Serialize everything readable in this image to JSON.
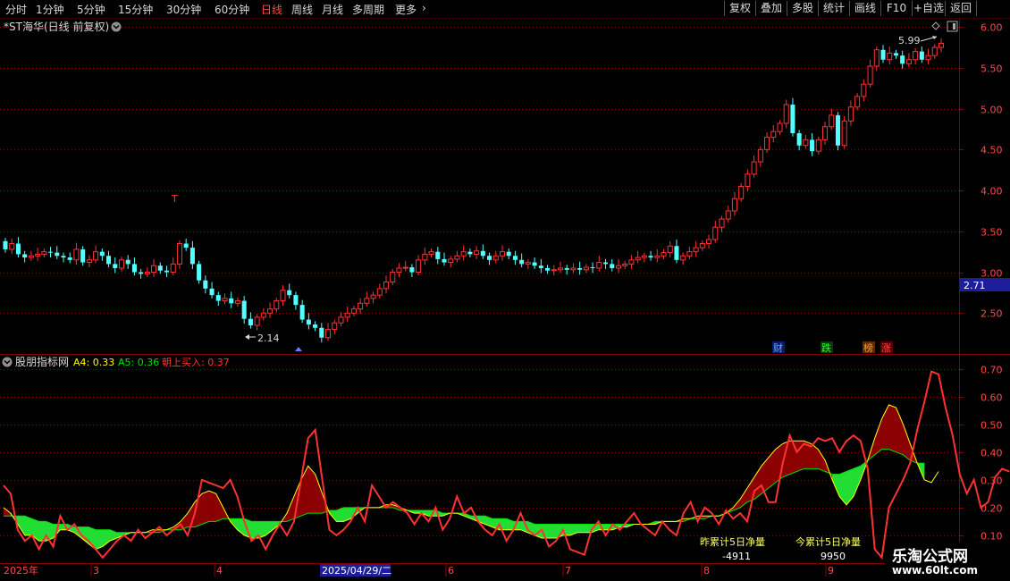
{
  "toolbar": {
    "periods": [
      "分时",
      "1分钟",
      "5分钟",
      "15分钟",
      "30分钟",
      "60分钟",
      "日线",
      "周线",
      "月线",
      "多周期",
      "更多"
    ],
    "active_period": "日线",
    "more_arrow": "›",
    "right_buttons": [
      "复权",
      "叠加",
      "多股",
      "统计",
      "画线",
      "F10",
      "+自选",
      "返回"
    ]
  },
  "main": {
    "title": "*ST海华(日线 前复权)",
    "high_marker": "5.99",
    "low_marker": "2.14",
    "current_price_tag": "2.71",
    "event_icons": [
      "财",
      "跌",
      "榜",
      "涨"
    ],
    "t_marker": "T"
  },
  "indicator": {
    "title": "股朋指标网",
    "a4_label": "A4: 0.33",
    "a5_label": "A5: 0.36",
    "buy_label": "朝上买入: 0.37",
    "prev_label": "昨累计5日净量",
    "prev_value": "-4911",
    "today_label": "今累计5日净量",
    "today_value": "9950"
  },
  "timeline": {
    "labels": [
      "2025年",
      "3",
      "4",
      "2025/04/29/二",
      "6",
      "7",
      "8",
      "9"
    ]
  },
  "watermark": {
    "line1": "乐淘公式网",
    "line2": "www.60lt.com"
  },
  "colors": {
    "up": "#ff3232",
    "down": "#54ffff",
    "grid": "#7a0000",
    "axis": "#8a0000",
    "title_text": "#d8d8d8",
    "a4": "#ffff00",
    "a5": "#00e000",
    "buy": "#ff3232",
    "green_fill": "#22dd33",
    "red_fill": "#8b0000",
    "tag_bg": "#1e1e9a"
  },
  "chart_data": [
    {
      "type": "candlestick",
      "title": "*ST海华(日线 前复权)",
      "ylim": [
        2.0,
        6.1
      ],
      "yticks": [
        2.5,
        3.0,
        3.5,
        4.0,
        4.5,
        5.0,
        5.5,
        6.0
      ],
      "max_label": 5.99,
      "min_label": 2.14,
      "closes": [
        3.28,
        3.35,
        3.22,
        3.18,
        3.2,
        3.22,
        3.25,
        3.24,
        3.2,
        3.18,
        3.15,
        3.28,
        3.12,
        3.15,
        3.25,
        3.2,
        3.1,
        3.05,
        3.15,
        3.1,
        3.0,
        2.98,
        3.0,
        3.08,
        3.02,
        3.0,
        3.1,
        3.35,
        3.3,
        3.1,
        2.9,
        2.8,
        2.72,
        2.65,
        2.68,
        2.62,
        2.65,
        2.43,
        2.35,
        2.45,
        2.5,
        2.55,
        2.65,
        2.78,
        2.72,
        2.6,
        2.42,
        2.36,
        2.32,
        2.2,
        2.3,
        2.38,
        2.45,
        2.5,
        2.55,
        2.62,
        2.68,
        2.72,
        2.8,
        2.88,
        3.0,
        3.05,
        3.06,
        3.0,
        3.15,
        3.22,
        3.25,
        3.16,
        3.12,
        3.16,
        3.2,
        3.25,
        3.22,
        3.26,
        3.2,
        3.15,
        3.2,
        3.25,
        3.2,
        3.15,
        3.1,
        3.12,
        3.08,
        3.05,
        3.02,
        3.03,
        3.05,
        3.03,
        3.05,
        3.03,
        3.06,
        3.05,
        3.12,
        3.1,
        3.05,
        3.08,
        3.1,
        3.15,
        3.18,
        3.2,
        3.18,
        3.2,
        3.24,
        3.32,
        3.15,
        3.2,
        3.25,
        3.3,
        3.35,
        3.4,
        3.55,
        3.65,
        3.75,
        3.9,
        4.05,
        4.2,
        4.35,
        4.5,
        4.65,
        4.72,
        4.82,
        5.05,
        4.7,
        4.55,
        4.62,
        4.48,
        4.62,
        4.78,
        4.92,
        4.55,
        4.85,
        5.02,
        5.15,
        5.3,
        5.52,
        5.72,
        5.6,
        5.68,
        5.65,
        5.55,
        5.6,
        5.7,
        5.6,
        5.65,
        5.75,
        5.8
      ],
      "opens": [
        3.38,
        3.28,
        3.35,
        3.22,
        3.18,
        3.2,
        3.22,
        3.25,
        3.24,
        3.2,
        3.18,
        3.15,
        3.28,
        3.12,
        3.15,
        3.25,
        3.2,
        3.1,
        3.05,
        3.15,
        3.1,
        3.0,
        2.98,
        3.0,
        3.08,
        3.02,
        3.0,
        3.1,
        3.35,
        3.3,
        3.1,
        2.9,
        2.8,
        2.72,
        2.65,
        2.68,
        2.62,
        2.65,
        2.43,
        2.35,
        2.45,
        2.5,
        2.55,
        2.65,
        2.78,
        2.72,
        2.6,
        2.42,
        2.36,
        2.32,
        2.2,
        2.3,
        2.38,
        2.45,
        2.5,
        2.55,
        2.62,
        2.68,
        2.72,
        2.8,
        2.88,
        3.0,
        3.05,
        3.06,
        3.0,
        3.15,
        3.22,
        3.25,
        3.16,
        3.12,
        3.16,
        3.2,
        3.25,
        3.22,
        3.26,
        3.2,
        3.15,
        3.2,
        3.25,
        3.2,
        3.15,
        3.1,
        3.12,
        3.08,
        3.05,
        3.02,
        3.03,
        3.05,
        3.03,
        3.05,
        3.03,
        3.06,
        3.05,
        3.12,
        3.1,
        3.05,
        3.08,
        3.1,
        3.15,
        3.18,
        3.2,
        3.18,
        3.2,
        3.24,
        3.32,
        3.15,
        3.2,
        3.25,
        3.3,
        3.35,
        3.4,
        3.55,
        3.65,
        3.75,
        3.9,
        4.05,
        4.2,
        4.35,
        4.5,
        4.65,
        4.72,
        4.82,
        5.05,
        4.7,
        4.55,
        4.62,
        4.48,
        4.62,
        4.78,
        4.92,
        4.55,
        4.85,
        5.02,
        5.15,
        5.3,
        5.52,
        5.72,
        5.6,
        5.68,
        5.65,
        5.55,
        5.6,
        5.7,
        5.6,
        5.65,
        5.75
      ]
    },
    {
      "type": "line",
      "title": "股朋指标网",
      "ylim": [
        0.0,
        0.75
      ],
      "yticks": [
        0.1,
        0.2,
        0.3,
        0.4,
        0.5,
        0.6,
        0.7
      ],
      "series": [
        {
          "name": "朝上买入",
          "color": "#ff3232",
          "values": [
            0.28,
            0.25,
            0.12,
            0.08,
            0.1,
            0.05,
            0.1,
            0.06,
            0.17,
            0.12,
            0.14,
            0.1,
            0.08,
            0.05,
            0.02,
            0.05,
            0.08,
            0.1,
            0.08,
            0.12,
            0.09,
            0.11,
            0.13,
            0.1,
            0.12,
            0.14,
            0.1,
            0.18,
            0.3,
            0.29,
            0.28,
            0.27,
            0.3,
            0.24,
            0.15,
            0.08,
            0.1,
            0.05,
            0.1,
            0.14,
            0.1,
            0.15,
            0.3,
            0.45,
            0.48,
            0.3,
            0.12,
            0.1,
            0.12,
            0.15,
            0.2,
            0.15,
            0.28,
            0.24,
            0.2,
            0.22,
            0.2,
            0.18,
            0.14,
            0.18,
            0.15,
            0.2,
            0.12,
            0.16,
            0.24,
            0.18,
            0.2,
            0.15,
            0.12,
            0.1,
            0.14,
            0.08,
            0.12,
            0.18,
            0.12,
            0.1,
            0.12,
            0.06,
            0.08,
            0.12,
            0.05,
            0.04,
            0.03,
            0.12,
            0.15,
            0.1,
            0.14,
            0.12,
            0.15,
            0.18,
            0.14,
            0.12,
            0.1,
            0.15,
            0.12,
            0.1,
            0.18,
            0.22,
            0.15,
            0.2,
            0.18,
            0.14,
            0.19,
            0.16,
            0.18,
            0.15,
            0.26,
            0.28,
            0.22,
            0.22,
            0.36,
            0.46,
            0.4,
            0.43,
            0.42,
            0.45,
            0.44,
            0.45,
            0.4,
            0.44,
            0.46,
            0.44,
            0.34,
            0.05,
            0.02,
            0.2,
            0.25,
            0.3,
            0.36,
            0.48,
            0.58,
            0.69,
            0.68,
            0.56,
            0.46,
            0.32,
            0.25,
            0.3,
            0.2,
            0.22,
            0.31,
            0.34,
            0.33
          ]
        },
        {
          "name": "A4",
          "color": "#ffff00",
          "values": [
            0.2,
            0.18,
            0.14,
            0.1,
            0.1,
            0.08,
            0.08,
            0.09,
            0.12,
            0.12,
            0.11,
            0.09,
            0.07,
            0.05,
            0.06,
            0.08,
            0.09,
            0.1,
            0.11,
            0.11,
            0.11,
            0.12,
            0.12,
            0.12,
            0.13,
            0.15,
            0.18,
            0.22,
            0.25,
            0.26,
            0.25,
            0.2,
            0.15,
            0.12,
            0.1,
            0.09,
            0.09,
            0.1,
            0.12,
            0.14,
            0.18,
            0.24,
            0.3,
            0.35,
            0.32,
            0.25,
            0.18,
            0.15,
            0.15,
            0.16,
            0.18,
            0.2,
            0.2,
            0.2,
            0.21,
            0.21,
            0.2,
            0.19,
            0.18,
            0.18,
            0.17,
            0.17,
            0.17,
            0.18,
            0.18,
            0.17,
            0.16,
            0.15,
            0.14,
            0.13,
            0.12,
            0.12,
            0.12,
            0.12,
            0.11,
            0.1,
            0.09,
            0.09,
            0.09,
            0.1,
            0.1,
            0.11,
            0.11,
            0.11,
            0.12,
            0.12,
            0.12,
            0.13,
            0.13,
            0.14,
            0.14,
            0.14,
            0.14,
            0.15,
            0.15,
            0.15,
            0.16,
            0.16,
            0.17,
            0.17,
            0.17,
            0.17,
            0.18,
            0.2,
            0.23,
            0.27,
            0.31,
            0.35,
            0.38,
            0.41,
            0.43,
            0.44,
            0.44,
            0.44,
            0.43,
            0.41,
            0.37,
            0.3,
            0.24,
            0.21,
            0.24,
            0.3,
            0.37,
            0.45,
            0.52,
            0.57,
            0.56,
            0.5,
            0.43,
            0.36,
            0.3,
            0.29,
            0.33
          ]
        },
        {
          "name": "A5",
          "color": "#00e000",
          "values": [
            0.17,
            0.17,
            0.17,
            0.17,
            0.16,
            0.15,
            0.15,
            0.14,
            0.14,
            0.14,
            0.13,
            0.13,
            0.13,
            0.12,
            0.12,
            0.12,
            0.11,
            0.11,
            0.11,
            0.11,
            0.11,
            0.11,
            0.11,
            0.12,
            0.12,
            0.12,
            0.13,
            0.13,
            0.14,
            0.15,
            0.15,
            0.16,
            0.16,
            0.16,
            0.16,
            0.15,
            0.15,
            0.15,
            0.15,
            0.15,
            0.15,
            0.16,
            0.17,
            0.18,
            0.18,
            0.18,
            0.19,
            0.19,
            0.2,
            0.2,
            0.2,
            0.2,
            0.2,
            0.2,
            0.2,
            0.2,
            0.19,
            0.19,
            0.19,
            0.19,
            0.19,
            0.19,
            0.18,
            0.18,
            0.18,
            0.18,
            0.17,
            0.17,
            0.17,
            0.16,
            0.16,
            0.16,
            0.15,
            0.15,
            0.15,
            0.14,
            0.14,
            0.14,
            0.14,
            0.14,
            0.14,
            0.14,
            0.14,
            0.14,
            0.14,
            0.14,
            0.14,
            0.14,
            0.14,
            0.14,
            0.14,
            0.14,
            0.15,
            0.15,
            0.15,
            0.15,
            0.15,
            0.16,
            0.16,
            0.16,
            0.17,
            0.17,
            0.18,
            0.19,
            0.2,
            0.22,
            0.23,
            0.25,
            0.27,
            0.29,
            0.31,
            0.32,
            0.33,
            0.34,
            0.34,
            0.34,
            0.33,
            0.32,
            0.32,
            0.33,
            0.34,
            0.35,
            0.37,
            0.39,
            0.41,
            0.41,
            0.4,
            0.39,
            0.37,
            0.36,
            0.36
          ]
        }
      ]
    }
  ]
}
